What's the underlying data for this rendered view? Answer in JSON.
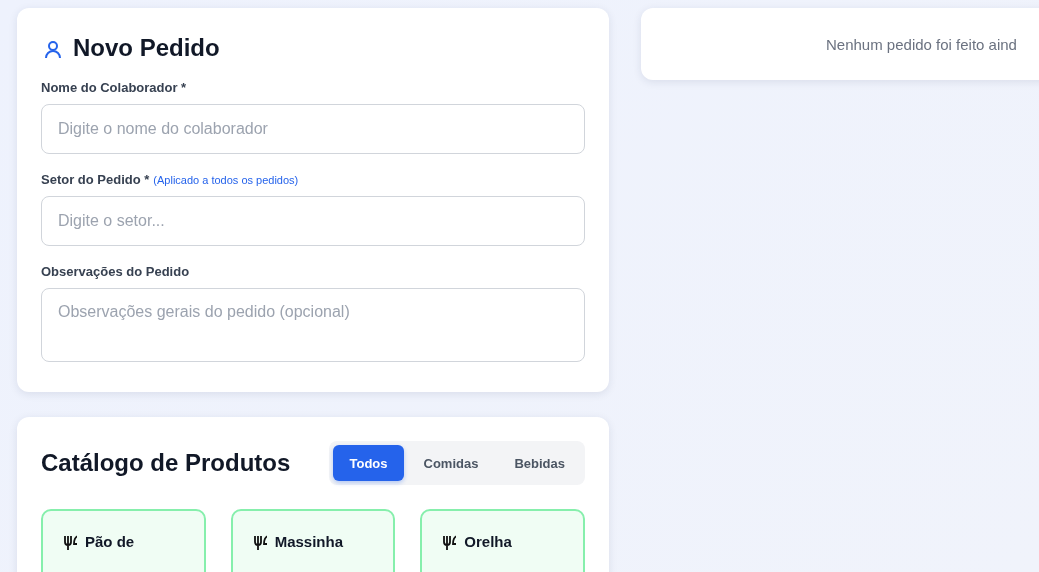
{
  "order_form": {
    "title": "Novo Pedido",
    "fields": [
      {
        "label": "Nome do Colaborador *",
        "placeholder": "Digite o nome do colaborador",
        "kind": "input"
      },
      {
        "label": "Setor do Pedido *",
        "hint": "(Aplicado a todos os pedidos)",
        "placeholder": "Digite o setor...",
        "kind": "input"
      },
      {
        "label": "Observações do Pedido",
        "placeholder": "Observações gerais do pedido (opcional)",
        "kind": "textarea"
      }
    ]
  },
  "catalog": {
    "title": "Catálogo de Produtos",
    "tabs": [
      {
        "label": "Todos",
        "selected": true
      },
      {
        "label": "Comidas",
        "selected": false
      },
      {
        "label": "Bebidas",
        "selected": false
      }
    ],
    "products": [
      {
        "name": "Pão de"
      },
      {
        "name": "Massinha"
      },
      {
        "name": "Orelha"
      }
    ]
  },
  "orders": {
    "empty_message": "Nenhum pedido foi feito aind"
  }
}
